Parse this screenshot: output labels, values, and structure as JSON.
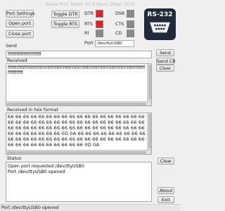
{
  "window": {
    "title": "Serial Port Tester V1.0 Hans Otten 2020"
  },
  "buttons": {
    "port_settings": "Port Settings",
    "open_port": "Open port",
    "close_port": "Close port",
    "toggle_dtr": "Toggle DTR",
    "toggle_rts": "Toggle RTS",
    "send": "Send",
    "send_cr": "Send CR",
    "clear_received": "Clear",
    "clear_status": "Clear",
    "about": "About",
    "exit": "Exit"
  },
  "signals": {
    "dtr": {
      "label": "DTR",
      "color": "#e81e1e"
    },
    "rts": {
      "label": "RTS",
      "color": "#e81e1e"
    },
    "ri": {
      "label": "RI",
      "color": "#8a8a8a"
    },
    "dsr": {
      "label": "DSR",
      "color": "#8a8a8a"
    },
    "cts": {
      "label": "CTS",
      "color": "#8a8a8a"
    },
    "cd": {
      "label": "CD",
      "color": "#8a8a8a"
    }
  },
  "port": {
    "label": "Port",
    "value": "/dev/ttyUSB0"
  },
  "logo": {
    "text": "RS-232",
    "icon": "db9-connector-icon"
  },
  "send": {
    "label": "Send",
    "value": "fffffffffffffffffffffff"
  },
  "received": {
    "label": "Received",
    "value": "ffffffffffffffffffffffffffffffffffffffffffffffffffffffffffffffffffffffffffffffffffffffffff\nffffffffff"
  },
  "received_hex": {
    "label": "Received in hex format",
    "value": "66 66 66 66 66 66 66 66 66 66 66 66 66 66 66 66 66 66 66 66 66 66 66 66 66 66 66 66 66 66 66 66 66 66 66 66 66 66 66 66 66 66 66 66 66 66 66 66 66 66 66 66 66 66 66 66 66 66 66 66 66 0D 0A 66 66 66 66 66 66 66 66 66 66 66 66 66 66 66 66 66 66 66 66 66 66 66 66 66 66 66 66 66 66 66 66 66 66 66 66 66 0D 0A"
  },
  "status": {
    "label": "Status",
    "lines": [
      "Open port requested /dev/ttyUSB0",
      "Port /dev/ttyUSB0 opened"
    ]
  },
  "statusbar": {
    "text": "Port /dev/ttyUSB0 opened"
  }
}
